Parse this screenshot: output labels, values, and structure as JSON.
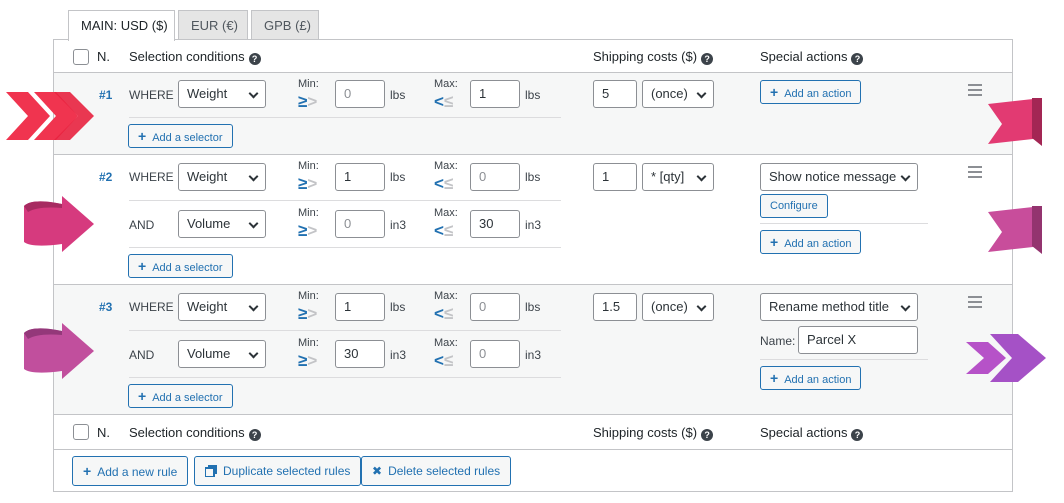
{
  "tabs": [
    "MAIN: USD ($)",
    "EUR (€)",
    "GPB (£)"
  ],
  "header": {
    "n": "N.",
    "selection": "Selection conditions",
    "shipping": "Shipping costs ($)",
    "special": "Special actions",
    "help": "?"
  },
  "rules": [
    {
      "num": "#1",
      "conditions": [
        {
          "op": "WHERE",
          "selector": "Weight",
          "min_label": "Min:",
          "min": "0",
          "min_unit": "lbs",
          "max_label": "Max:",
          "max": "1",
          "max_unit": "lbs"
        }
      ],
      "add_selector": "Add a selector",
      "cost": "5",
      "cost_mode": "(once)",
      "actions": [],
      "add_action": "Add an action"
    },
    {
      "num": "#2",
      "conditions": [
        {
          "op": "WHERE",
          "selector": "Weight",
          "min_label": "Min:",
          "min": "1",
          "min_unit": "lbs",
          "max_label": "Max:",
          "max": "0",
          "max_unit": "lbs"
        },
        {
          "op": "AND",
          "selector": "Volume",
          "min_label": "Min:",
          "min": "0",
          "min_unit": "in3",
          "max_label": "Max:",
          "max": "30",
          "max_unit": "in3"
        }
      ],
      "add_selector": "Add a selector",
      "cost": "1",
      "cost_mode": "* [qty]",
      "actions": [
        {
          "type": "Show notice message",
          "configure": "Configure"
        }
      ],
      "add_action": "Add an action"
    },
    {
      "num": "#3",
      "conditions": [
        {
          "op": "WHERE",
          "selector": "Weight",
          "min_label": "Min:",
          "min": "1",
          "min_unit": "lbs",
          "max_label": "Max:",
          "max": "0",
          "max_unit": "lbs"
        },
        {
          "op": "AND",
          "selector": "Volume",
          "min_label": "Min:",
          "min": "30",
          "min_unit": "in3",
          "max_label": "Max:",
          "max": "0",
          "max_unit": "in3"
        }
      ],
      "add_selector": "Add a selector",
      "cost": "1.5",
      "cost_mode": "(once)",
      "actions": [
        {
          "type": "Rename method title",
          "name_label": "Name:",
          "name_value": "Parcel X"
        }
      ],
      "add_action": "Add an action"
    }
  ],
  "footer": {
    "add_rule": "Add a new rule",
    "duplicate": "Duplicate selected rules",
    "delete": "Delete selected rules"
  },
  "colors": {
    "accent": "#2271b1",
    "arrow_red": "#f0344f",
    "arrow_pink": "#d63a7e",
    "arrow_magenta": "#c14f9d",
    "arrow_purple": "#a551c6"
  }
}
